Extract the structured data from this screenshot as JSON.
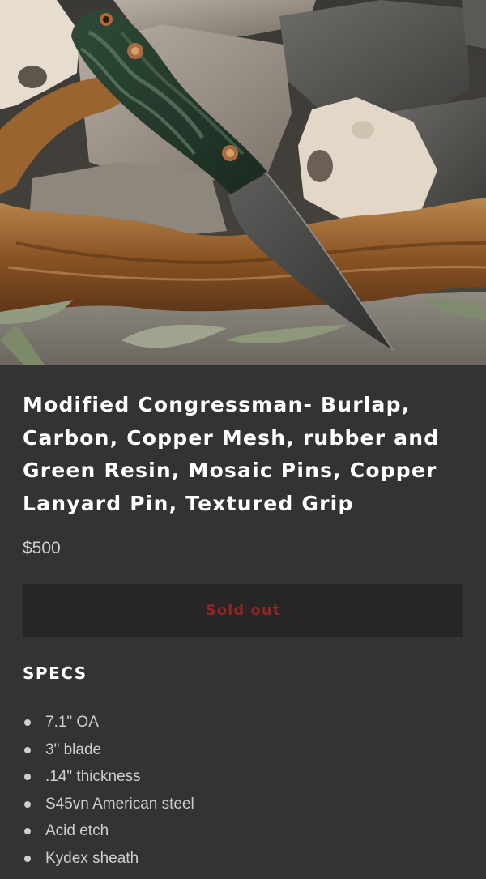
{
  "product": {
    "title": "Modified Congressman- Burlap, Carbon, Copper Mesh, rubber and Green Resin, Mosaic Pins, Copper Lanyard Pin, Textured Grip",
    "price": "$500",
    "sold_out_label": "Sold out"
  },
  "specs": {
    "heading": "SPECS",
    "items": [
      "7.1\" OA",
      "3\" blade",
      ".14\" thickness",
      "S45vn American steel",
      "Acid etch",
      "Kydex sheath"
    ]
  },
  "colors": {
    "page_background": "#333333",
    "button_background": "#262626",
    "sold_out_text": "#8e2622",
    "title_text": "#ffffff",
    "body_text": "#cfcfcf"
  }
}
